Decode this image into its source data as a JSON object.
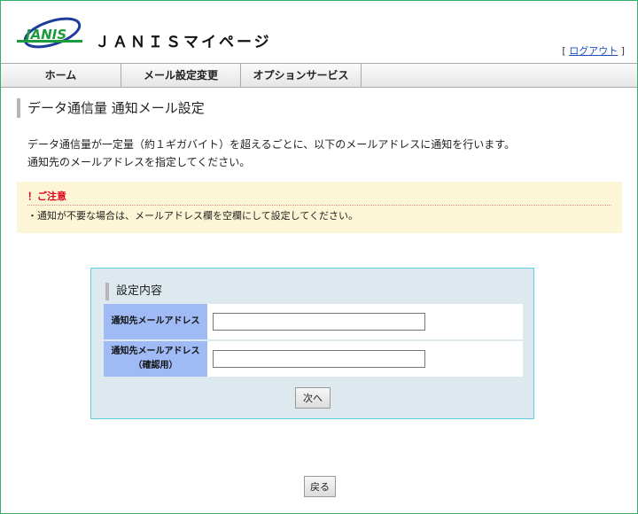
{
  "header": {
    "site_title": "ＪＡＮＩＳマイページ",
    "logo_text": "JANIS",
    "logout_open": "[ ",
    "logout_label": "ログアウト",
    "logout_close": " ]"
  },
  "nav": {
    "items": [
      {
        "label": "ホーム"
      },
      {
        "label": "メール設定変更"
      },
      {
        "label": "オプションサービス"
      }
    ]
  },
  "page": {
    "title": "データ通信量 通知メール設定",
    "desc_line1": "データ通信量が一定量（約１ギガバイト）を超えるごとに、以下のメールアドレスに通知を行います。",
    "desc_line2": "通知先のメールアドレスを指定してください。"
  },
  "caution": {
    "title": "！ご注意",
    "text": "・通知が不要な場合は、メールアドレス欄を空欄にして設定してください。"
  },
  "settings": {
    "title": "設定内容",
    "rows": [
      {
        "label_line1": "通知先メールアドレス",
        "label_line2": "",
        "value": ""
      },
      {
        "label_line1": "通知先メールアドレス",
        "label_line2": "（確認用）",
        "value": ""
      }
    ],
    "next_label": "次へ"
  },
  "back_label": "戻る",
  "colors": {
    "frame_border": "#34b06a",
    "caution_bg": "#fdf6d6",
    "caution_title": "#e0001b",
    "settings_bg": "#dde9ee",
    "settings_border": "#5fd0dd",
    "label_bg": "#9fbaf4",
    "logo_green": "#1c9a3e",
    "logo_blue": "#1e3c9a"
  },
  "icons": {
    "logo": "janis-logo-icon"
  }
}
